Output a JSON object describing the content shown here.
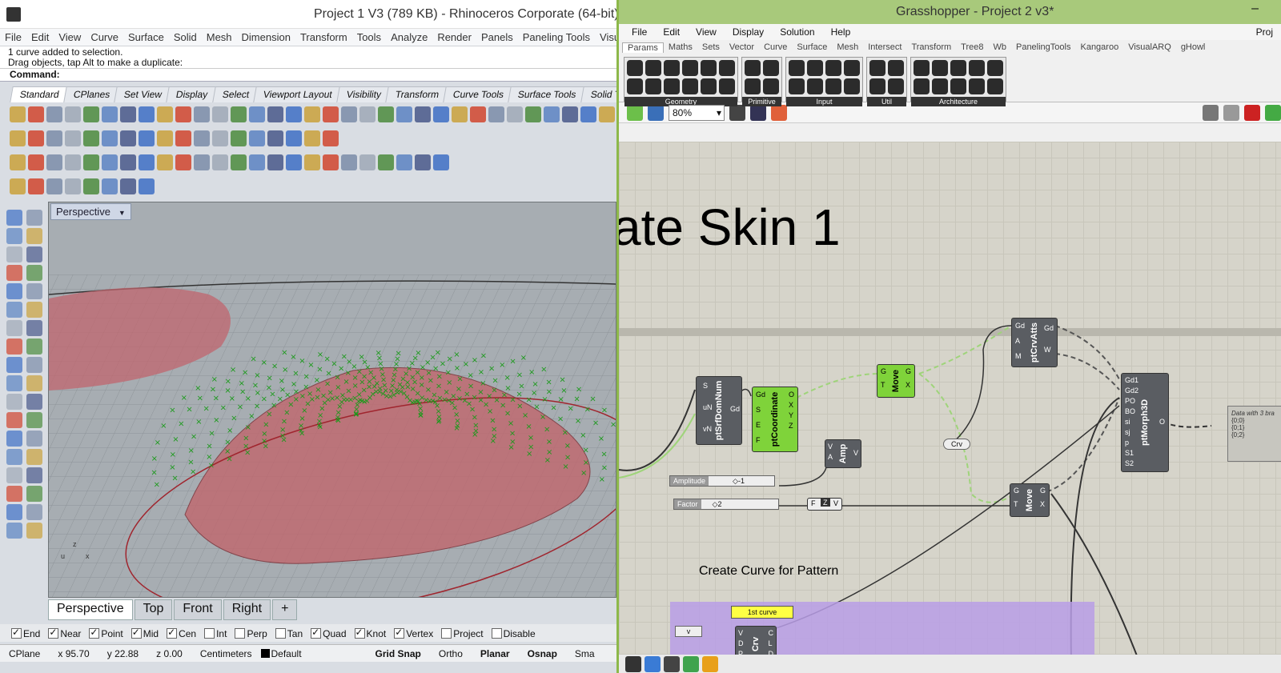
{
  "rhino": {
    "title": "Project 1 V3 (789 KB) - Rhinoceros Corporate (64-bit) -",
    "menu": [
      "File",
      "Edit",
      "View",
      "Curve",
      "Surface",
      "Solid",
      "Mesh",
      "Dimension",
      "Transform",
      "Tools",
      "Analyze",
      "Render",
      "Panels",
      "Paneling Tools",
      "VisualARQ"
    ],
    "history": [
      "1 curve added to selection.",
      "Drag objects, tap Alt to make a duplicate:"
    ],
    "command_label": "Command:",
    "toolbar_tabs": [
      "Standard",
      "CPlanes",
      "Set View",
      "Display",
      "Select",
      "Viewport Layout",
      "Visibility",
      "Transform",
      "Curve Tools",
      "Surface Tools",
      "Solid Tools"
    ],
    "viewport_label": "Perspective",
    "viewport_tabs": [
      "Perspective",
      "Top",
      "Front",
      "Right",
      "+"
    ],
    "osnaps": [
      {
        "label": "End",
        "checked": true
      },
      {
        "label": "Near",
        "checked": true
      },
      {
        "label": "Point",
        "checked": true
      },
      {
        "label": "Mid",
        "checked": true
      },
      {
        "label": "Cen",
        "checked": true
      },
      {
        "label": "Int",
        "checked": false
      },
      {
        "label": "Perp",
        "checked": false
      },
      {
        "label": "Tan",
        "checked": false
      },
      {
        "label": "Quad",
        "checked": true
      },
      {
        "label": "Knot",
        "checked": true
      },
      {
        "label": "Vertex",
        "checked": true
      },
      {
        "label": "Project",
        "checked": false
      },
      {
        "label": "Disable",
        "checked": false
      }
    ],
    "status": {
      "cplane": "CPlane",
      "x": "x 95.70",
      "y": "y 22.88",
      "z": "z 0.00",
      "units": "Centimeters",
      "layer": "Default",
      "grid_snap": "Grid Snap",
      "ortho": "Ortho",
      "planar": "Planar",
      "osnap": "Osnap",
      "smart": "Sma"
    },
    "colors": {
      "surface": "#b96a72",
      "points": "#1a9a1a",
      "viewport_bg": "#9fa5aa"
    }
  },
  "gh": {
    "title": "Grasshopper - Project 2 v3*",
    "menu": [
      "File",
      "Edit",
      "View",
      "Display",
      "Solution",
      "Help"
    ],
    "proj_label": "Proj",
    "tabs": [
      "Params",
      "Maths",
      "Sets",
      "Vector",
      "Curve",
      "Surface",
      "Mesh",
      "Intersect",
      "Transform",
      "Tree8",
      "Wb",
      "PanelingTools",
      "Kangaroo",
      "VisualARQ",
      "gHowl"
    ],
    "ribbon_groups": [
      "Geometry",
      "Primitive",
      "Input",
      "Util",
      "Architecture"
    ],
    "zoom": "80%",
    "canvas_title": "ate Skin 1",
    "section_title": "Create Curve for Pattern",
    "components": {
      "srf": {
        "name": "ptSrfDomNum",
        "inputs": [
          "S",
          "uN",
          "vN"
        ],
        "outputs": [
          "Gd"
        ]
      },
      "coord": {
        "name": "ptCoordinate",
        "inputs": [
          "Gd",
          "S",
          "E",
          "F"
        ],
        "outputs": [
          "O",
          "X",
          "Y",
          "Z"
        ]
      },
      "move1": {
        "name": "Move",
        "inputs": [
          "G",
          "T"
        ],
        "outputs": [
          "G",
          "X"
        ]
      },
      "amp": {
        "name": "Amp",
        "inputs": [
          "V",
          "A"
        ],
        "outputs": [
          "V"
        ]
      },
      "crvatts": {
        "name": "ptCrvAtts",
        "inputs": [
          "Gd",
          "A",
          "M"
        ],
        "outputs": [
          "Gd",
          "W"
        ]
      },
      "morph": {
        "name": "ptMorph3D",
        "inputs": [
          "Gd1",
          "Gd2",
          "PO",
          "BO",
          "si",
          "sj",
          "p",
          "S1",
          "S2"
        ],
        "outputs": [
          "O"
        ]
      },
      "move2": {
        "name": "Move",
        "inputs": [
          "G",
          "T"
        ],
        "outputs": [
          "G",
          "X"
        ]
      },
      "crv": {
        "name": "Crv",
        "inputs": [
          "V",
          "D",
          "P"
        ],
        "outputs": [
          "C",
          "L",
          "D"
        ]
      }
    },
    "sliders": [
      {
        "label": "Amplitude",
        "value": "-1"
      },
      {
        "label": "Factor",
        "value": "2"
      }
    ],
    "crv_param": "Crv",
    "z_node": {
      "inputs": [
        "F"
      ],
      "outputs": [
        "V"
      ],
      "label": "Z"
    },
    "panel_text": [
      "Data with 3 bra",
      "{0;0}",
      "{0;1}",
      "{0;2}"
    ],
    "label_1st": "1st curve",
    "v_label": "v"
  }
}
